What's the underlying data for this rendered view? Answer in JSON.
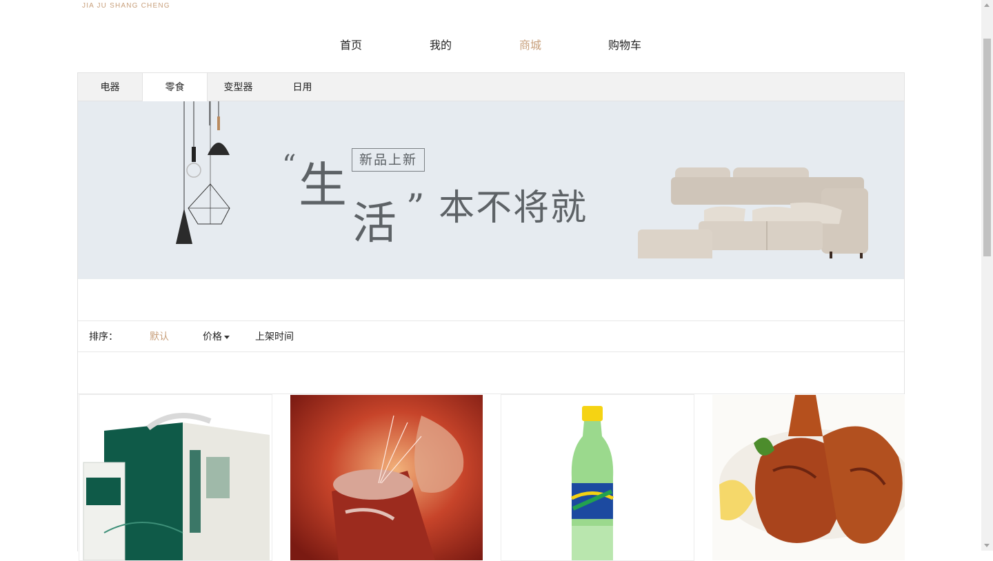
{
  "brand": {
    "subtitle": "JIA JU SHANG CHENG"
  },
  "nav": {
    "items": [
      {
        "label": "首页"
      },
      {
        "label": "我的"
      },
      {
        "label": "商城",
        "active": true
      },
      {
        "label": "购物车"
      }
    ]
  },
  "categories": {
    "tabs": [
      {
        "label": "电器"
      },
      {
        "label": "零食",
        "active": true
      },
      {
        "label": "变型器"
      },
      {
        "label": "日用"
      }
    ]
  },
  "banner": {
    "badge": "新品上新",
    "slogan": {
      "open_quote": "“",
      "char1": "生",
      "char2": "活",
      "rest": "” 本不将就"
    }
  },
  "sort": {
    "label": "排序：",
    "options": [
      {
        "label": "默认",
        "active": true
      },
      {
        "label": "价格",
        "icon": "caret-down-icon"
      },
      {
        "label": "上架时间"
      }
    ]
  },
  "products": [
    {
      "image": "milk-carton-image"
    },
    {
      "image": "cola-can-splash-image"
    },
    {
      "image": "sprite-bottle-image"
    },
    {
      "image": "roast-chicken-legs-image"
    }
  ],
  "colors": {
    "accent": "#c8a07c",
    "banner_bg": "#e6ebf0",
    "tabbar_bg": "#f2f2f2"
  }
}
